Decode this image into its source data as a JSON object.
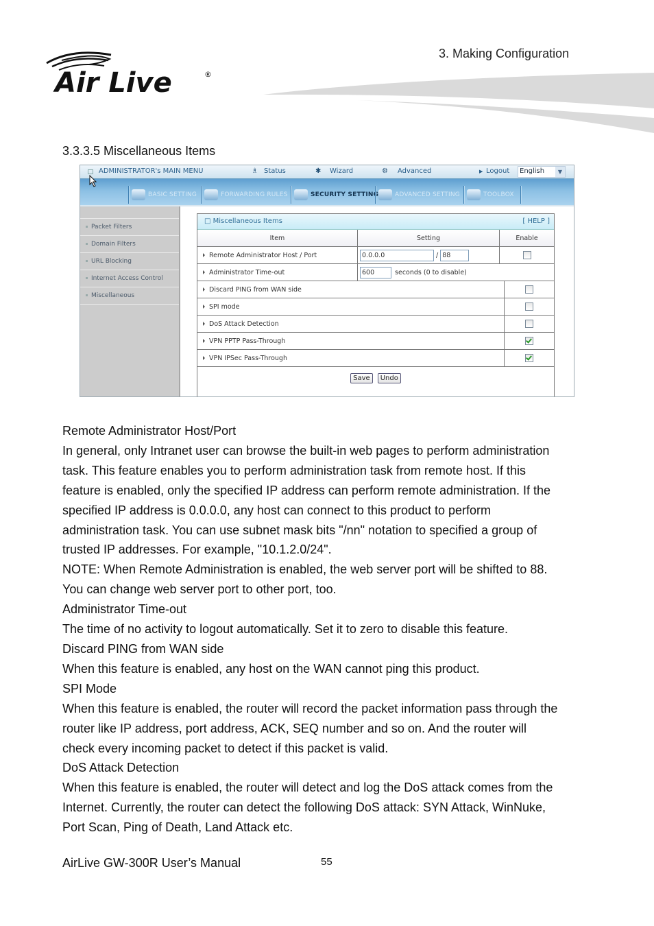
{
  "header": {
    "chapter": "3.  Making  Configuration",
    "logo_text": "Air Live",
    "logo_mark": "®"
  },
  "section_title": "3.3.3.5 Miscellaneous Items",
  "router_ui": {
    "topbar": {
      "main_menu": "ADMINISTRATOR's MAIN MENU",
      "status": "Status",
      "wizard": "Wizard",
      "advanced": "Advanced",
      "logout": "Logout",
      "language": "English"
    },
    "nav_tabs": [
      {
        "label": "BASIC SETTING",
        "active": false
      },
      {
        "label": "FORWARDING RULES",
        "active": false
      },
      {
        "label": "SECURITY SETTING",
        "active": true
      },
      {
        "label": "ADVANCED SETTING",
        "active": false
      },
      {
        "label": "TOOLBOX",
        "active": false
      }
    ],
    "sidebar": [
      {
        "label": "Packet Filters"
      },
      {
        "label": "Domain Filters"
      },
      {
        "label": "URL Blocking"
      },
      {
        "label": "Internet Access Control"
      },
      {
        "label": "Miscellaneous"
      }
    ],
    "panel": {
      "title": "Miscellaneous Items",
      "help": "[ HELP ]",
      "columns": {
        "item": "Item",
        "setting": "Setting",
        "enable": "Enable"
      },
      "remote_admin": {
        "label": "Remote Administrator Host / Port",
        "host": "0.0.0.0",
        "sep": "/",
        "port": "88",
        "enabled": false
      },
      "timeout": {
        "label": "Administrator Time-out",
        "value": "600",
        "suffix": "seconds (0 to disable)"
      },
      "rows": [
        {
          "label": "Discard PING from WAN side",
          "enabled": false
        },
        {
          "label": "SPI mode",
          "enabled": false
        },
        {
          "label": "DoS Attack Detection",
          "enabled": false
        },
        {
          "label": "VPN PPTP Pass-Through",
          "enabled": true
        },
        {
          "label": "VPN IPSec Pass-Through",
          "enabled": true
        }
      ],
      "save": "Save",
      "undo": "Undo"
    }
  },
  "body": [
    "Remote Administrator Host/Port",
    "In general, only Intranet user can browse the built-in web pages to perform administration",
    "task. This feature enables you to perform administration task from remote host. If this",
    "feature is enabled, only the specified IP address can perform remote administration. If the",
    "specified IP address is 0.0.0.0, any host can connect to this product to perform",
    "administration task. You can use subnet mask bits \"/nn\" notation to specified a group of",
    "trusted IP addresses. For example, \"10.1.2.0/24\".",
    "NOTE: When Remote Administration is enabled, the web server port will be shifted to 88.",
    "You can change web server port to other port, too.",
    "Administrator Time-out",
    "The time of no activity to logout automatically. Set it to zero to disable this feature.",
    "Discard PING from WAN side",
    "When this feature is enabled, any host on the WAN cannot ping this product.",
    "SPI Mode",
    "When this feature is enabled, the router will record the packet information pass through the",
    "router like IP address, port address, ACK, SEQ number and so on. And the router will",
    "check every incoming packet to detect if this packet is valid.",
    "DoS Attack Detection",
    "When this feature is enabled, the router will detect and log the DoS attack comes from the",
    "Internet. Currently, the router can detect the following DoS attack: SYN Attack, WinNuke,",
    "Port Scan, Ping of Death, Land Attack etc."
  ],
  "footer": {
    "manual": "AirLive GW-300R User’s Manual",
    "page": "55"
  }
}
